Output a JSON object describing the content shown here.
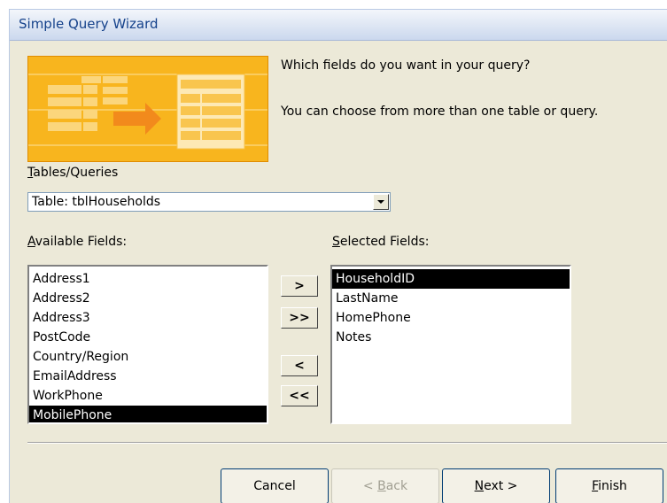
{
  "window": {
    "title": "Simple Query Wizard"
  },
  "intro": {
    "question": "Which fields do you want in your query?",
    "hint": "You can choose from more than one table or query."
  },
  "tables_queries": {
    "label_first": "T",
    "label_rest": "ables/Queries",
    "selected_value": "Table: tblHouseholds"
  },
  "available_fields": {
    "label_first": "A",
    "label_rest": "vailable Fields:",
    "items": [
      "Address1",
      "Address2",
      "Address3",
      "PostCode",
      "Country/Region",
      "EmailAddress",
      "WorkPhone",
      "MobilePhone"
    ],
    "selected_index": 7
  },
  "selected_fields": {
    "label_first": "S",
    "label_rest": "elected Fields:",
    "items": [
      "HouseholdID",
      "LastName",
      "HomePhone",
      "Notes"
    ],
    "selected_index": 0
  },
  "move_buttons": {
    "add_one": ">",
    "add_all": ">>",
    "remove_one": "<",
    "remove_all": "<<"
  },
  "footer": {
    "cancel": "Cancel",
    "back_prefix": "< ",
    "back_key": "B",
    "back_rest": "ack",
    "next_key": "N",
    "next_rest": "ext >",
    "finish_key": "F",
    "finish_rest": "inish"
  },
  "colors": {
    "banner": "#f8b51e",
    "selection": "#000000",
    "title_text": "#15428b"
  },
  "icons": {
    "banner": "table-to-table-arrow-icon",
    "dropdown": "chevron-down-icon"
  }
}
